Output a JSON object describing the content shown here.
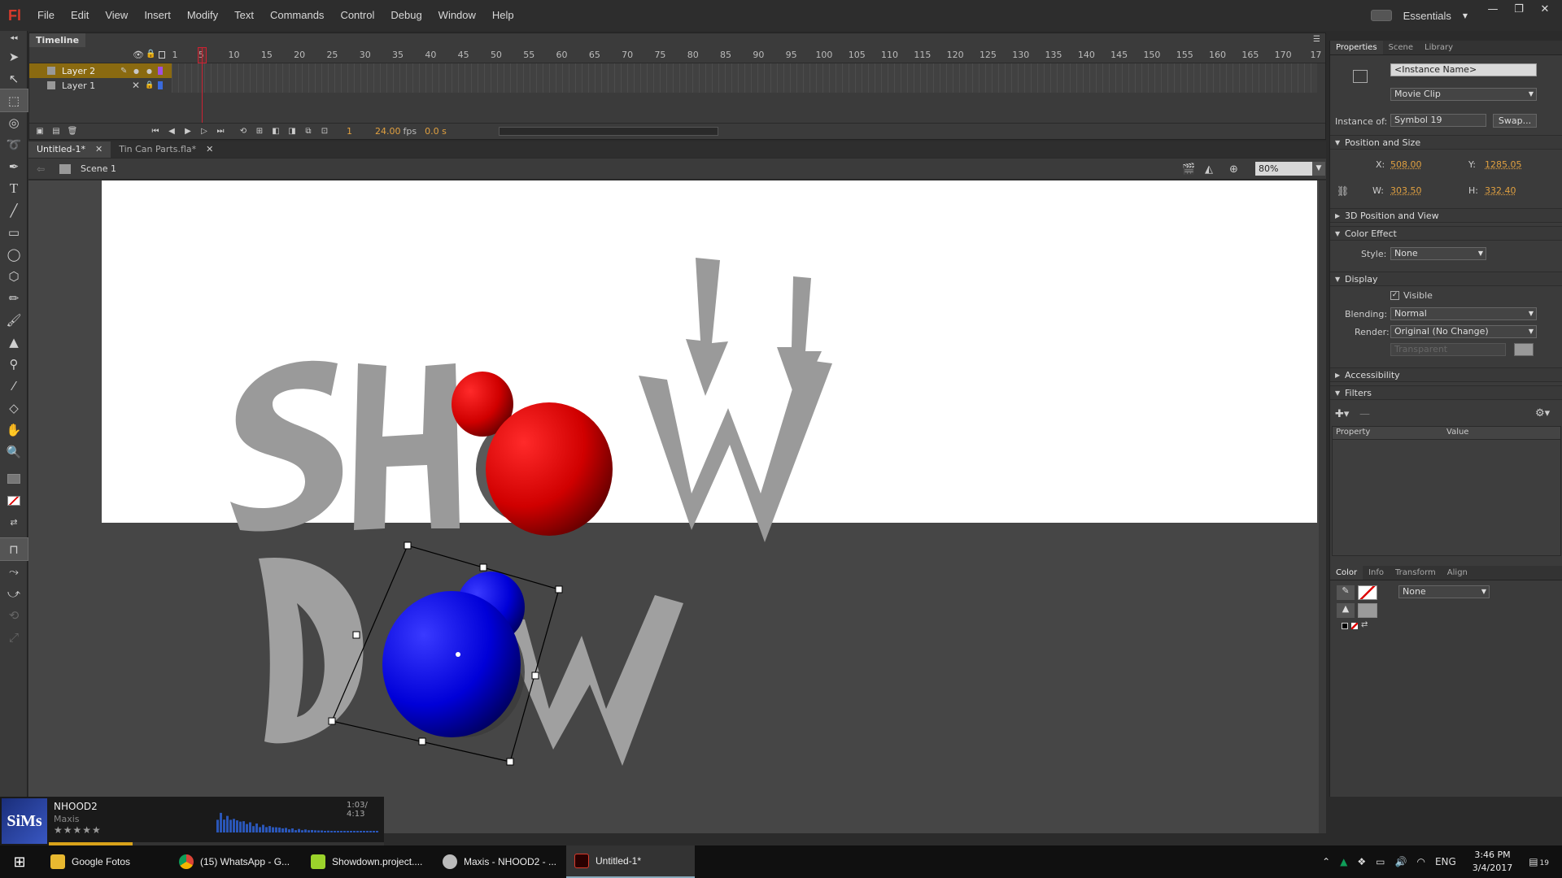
{
  "app": {
    "logo": "Fl",
    "workspace": "Essentials"
  },
  "menu": [
    "File",
    "Edit",
    "View",
    "Insert",
    "Modify",
    "Text",
    "Commands",
    "Control",
    "Debug",
    "Window",
    "Help"
  ],
  "timeline": {
    "tab_label": "Timeline",
    "ruler": [
      "1",
      "5",
      "10",
      "15",
      "20",
      "25",
      "30",
      "35",
      "40",
      "45",
      "50",
      "55",
      "60",
      "65",
      "70",
      "75",
      "80",
      "85",
      "90",
      "95",
      "100",
      "105",
      "110",
      "115",
      "120",
      "125",
      "130",
      "135",
      "140",
      "145",
      "150",
      "155",
      "160",
      "165",
      "170",
      "17"
    ],
    "layers": [
      {
        "name": "Layer 2",
        "selected": true,
        "color": "#a050e0"
      },
      {
        "name": "Layer 1",
        "selected": false,
        "color": "#3a6adc"
      }
    ],
    "current_frame": "1",
    "fps": "24.00",
    "fps_unit": "fps",
    "time": "0.0 s"
  },
  "documents": {
    "tabs": [
      {
        "label": "Untitled-1*",
        "active": true
      },
      {
        "label": "Tin Can Parts.fla*",
        "active": false
      }
    ],
    "scene": "Scene 1",
    "zoom": "80%"
  },
  "stage": {
    "stage_color": "#ffffff",
    "pasteboard_color": "#464646",
    "word1": "SHOW",
    "word2": "DOW",
    "red_ball_color": "#e00000",
    "blue_ball_color": "#0000e0"
  },
  "properties": {
    "tabs": [
      "Properties",
      "Scene",
      "Library"
    ],
    "instance_name_placeholder": "<Instance Name>",
    "symbol_type": "Movie Clip",
    "instance_of_label": "Instance of:",
    "instance_of_value": "Symbol 19",
    "swap_label": "Swap...",
    "position_size": {
      "header": "Position and Size",
      "x_label": "X:",
      "x": "508.00",
      "y_label": "Y:",
      "y": "1285.05",
      "w_label": "W:",
      "w": "303.50",
      "h_label": "H:",
      "h": "332.40"
    },
    "position_3d_header": "3D Position and View",
    "color_effect": {
      "header": "Color Effect",
      "style_label": "Style:",
      "style_value": "None"
    },
    "display": {
      "header": "Display",
      "visible_label": "Visible",
      "blending_label": "Blending:",
      "blending_value": "Normal",
      "render_label": "Render:",
      "render_value": "Original (No Change)",
      "transparent_value": "Transparent"
    },
    "accessibility_header": "Accessibility",
    "filters": {
      "header": "Filters",
      "col_property": "Property",
      "col_value": "Value"
    }
  },
  "color_panel": {
    "tabs": [
      "Color",
      "Info",
      "Transform",
      "Align"
    ],
    "type_value": "None"
  },
  "music": {
    "title": "NHOOD2",
    "artist": "Maxis",
    "stars": "★★★★★",
    "time": "1:03/ 4:13",
    "album_art_text": "SiMs",
    "progress": 0.25
  },
  "taskbar": {
    "items": [
      {
        "label": "Google Fotos",
        "color": "#e8b830"
      },
      {
        "label": "(15) WhatsApp - G...",
        "color": "#4caf50"
      },
      {
        "label": "Showdown.project....",
        "color": "#9bd32b"
      },
      {
        "label": "Maxis - NHOOD2 - ...",
        "color": "#bbbbbb"
      },
      {
        "label": "Untitled-1*",
        "color": "#d93a2b"
      }
    ],
    "language": "ENG",
    "time": "3:46 PM",
    "date": "3/4/2017",
    "notifications": "19"
  }
}
